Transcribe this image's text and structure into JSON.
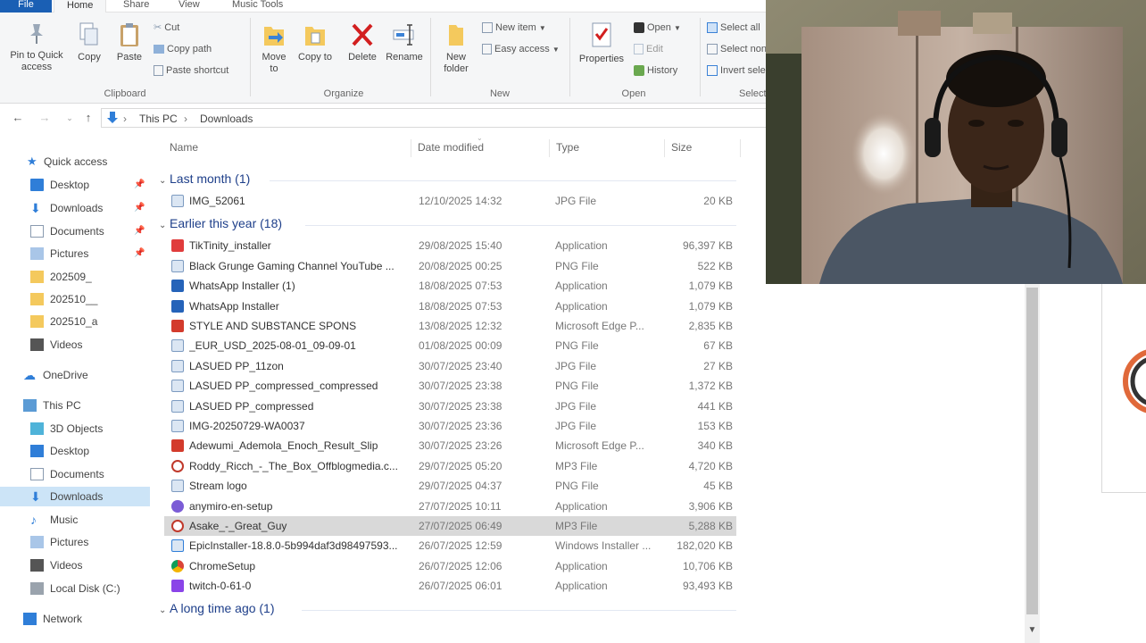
{
  "ribbon_tabs": [
    "File",
    "Home",
    "Share",
    "View",
    "Music Tools"
  ],
  "ribbon": {
    "pin_quick_access": "Pin to Quick access",
    "copy": "Copy",
    "paste": "Paste",
    "cut": "Cut",
    "copy_path": "Copy path",
    "paste_shortcut": "Paste shortcut",
    "clipboard_group": "Clipboard",
    "move_to": "Move to",
    "copy_to": "Copy to",
    "delete": "Delete",
    "rename": "Rename",
    "organize_group": "Organize",
    "new_folder": "New folder",
    "new_item": "New item",
    "easy_access": "Easy access",
    "new_group": "New",
    "properties": "Properties",
    "open": "Open",
    "edit": "Edit",
    "history": "History",
    "open_group": "Open",
    "select_all": "Select all",
    "select_none": "Select none",
    "invert_selection": "Invert selection",
    "select_group": "Select"
  },
  "address": {
    "crumbs": [
      "This PC",
      "Downloads"
    ]
  },
  "nav": {
    "quick_access": "Quick access",
    "quick_items": [
      {
        "label": "Desktop",
        "pinned": true
      },
      {
        "label": "Downloads",
        "pinned": true
      },
      {
        "label": "Documents",
        "pinned": true
      },
      {
        "label": "Pictures",
        "pinned": true
      },
      {
        "label": "202509_",
        "pinned": false
      },
      {
        "label": "202510__",
        "pinned": false
      },
      {
        "label": "202510_a",
        "pinned": false
      },
      {
        "label": "Videos",
        "pinned": false
      }
    ],
    "onedrive": "OneDrive",
    "this_pc": "This PC",
    "pc_items": [
      "3D Objects",
      "Desktop",
      "Documents",
      "Downloads",
      "Music",
      "Pictures",
      "Videos",
      "Local Disk (C:)"
    ],
    "network": "Network"
  },
  "columns": {
    "name": "Name",
    "date": "Date modified",
    "type": "Type",
    "size": "Size"
  },
  "groups": [
    {
      "title": "Last month (1)",
      "files": [
        {
          "name": "IMG_52061",
          "date": "12/10/2025 14:32",
          "type": "JPG File",
          "size": "20 KB",
          "icon": "image-icon"
        }
      ]
    },
    {
      "title": "Earlier this year (18)",
      "files": [
        {
          "name": "TikTinity_installer",
          "date": "29/08/2025 15:40",
          "type": "Application",
          "size": "96,397 KB",
          "icon": "installer-icon"
        },
        {
          "name": "Black Grunge Gaming Channel YouTube ...",
          "date": "20/08/2025 00:25",
          "type": "PNG File",
          "size": "522 KB",
          "icon": "image-icon"
        },
        {
          "name": "WhatsApp Installer (1)",
          "date": "18/08/2025 07:53",
          "type": "Application",
          "size": "1,079 KB",
          "icon": "download-app-icon"
        },
        {
          "name": "WhatsApp Installer",
          "date": "18/08/2025 07:53",
          "type": "Application",
          "size": "1,079 KB",
          "icon": "download-app-icon"
        },
        {
          "name": "STYLE AND SUBSTANCE SPONS",
          "date": "13/08/2025 12:32",
          "type": "Microsoft Edge P...",
          "size": "2,835 KB",
          "icon": "pdf-icon"
        },
        {
          "name": "_EUR_USD_2025-08-01_09-09-01",
          "date": "01/08/2025 00:09",
          "type": "PNG File",
          "size": "67 KB",
          "icon": "image-icon"
        },
        {
          "name": "LASUED PP_11zon",
          "date": "30/07/2025 23:40",
          "type": "JPG File",
          "size": "27 KB",
          "icon": "image-icon"
        },
        {
          "name": "LASUED PP_compressed_compressed",
          "date": "30/07/2025 23:38",
          "type": "PNG File",
          "size": "1,372 KB",
          "icon": "image-icon"
        },
        {
          "name": "LASUED PP_compressed",
          "date": "30/07/2025 23:38",
          "type": "JPG File",
          "size": "441 KB",
          "icon": "image-icon"
        },
        {
          "name": "IMG-20250729-WA0037",
          "date": "30/07/2025 23:36",
          "type": "JPG File",
          "size": "153 KB",
          "icon": "image-icon"
        },
        {
          "name": "Adewumi_Ademola_Enoch_Result_Slip",
          "date": "30/07/2025 23:26",
          "type": "Microsoft Edge P...",
          "size": "340 KB",
          "icon": "pdf-icon"
        },
        {
          "name": "Roddy_Ricch_-_The_Box_Offblogmedia.c...",
          "date": "29/07/2025 05:20",
          "type": "MP3 File",
          "size": "4,720 KB",
          "icon": "audio-icon"
        },
        {
          "name": "Stream logo",
          "date": "29/07/2025 04:37",
          "type": "PNG File",
          "size": "45 KB",
          "icon": "image-icon"
        },
        {
          "name": "anymiro-en-setup",
          "date": "27/07/2025 10:11",
          "type": "Application",
          "size": "3,906 KB",
          "icon": "setup-icon"
        },
        {
          "name": "Asake_-_Great_Guy",
          "date": "27/07/2025 06:49",
          "type": "MP3 File",
          "size": "5,288 KB",
          "icon": "audio-icon",
          "selected": true
        },
        {
          "name": "EpicInstaller-18.8.0-5b994daf3d98497593...",
          "date": "26/07/2025 12:59",
          "type": "Windows Installer ...",
          "size": "182,020 KB",
          "icon": "msi-icon"
        },
        {
          "name": "ChromeSetup",
          "date": "26/07/2025 12:06",
          "type": "Application",
          "size": "10,706 KB",
          "icon": "chrome-icon"
        },
        {
          "name": "twitch-0-61-0",
          "date": "26/07/2025 06:01",
          "type": "Application",
          "size": "93,493 KB",
          "icon": "twitch-icon"
        }
      ]
    },
    {
      "title": "A long time ago (1)",
      "files": []
    }
  ],
  "colors": {
    "file_tab": "#1a5fb4",
    "group_header": "#1e3f8a",
    "selection": "#d9d9d9",
    "nav_selection": "#cce4f7"
  }
}
